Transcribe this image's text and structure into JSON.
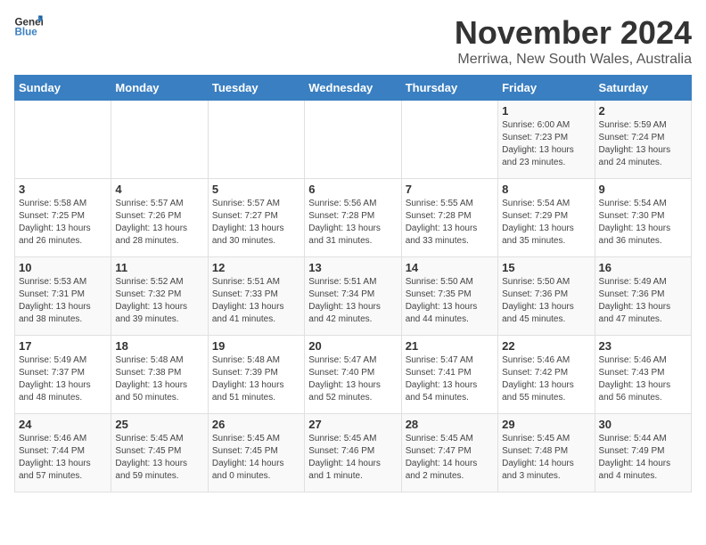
{
  "logo": {
    "general": "General",
    "blue": "Blue"
  },
  "title": "November 2024",
  "location": "Merriwa, New South Wales, Australia",
  "weekdays": [
    "Sunday",
    "Monday",
    "Tuesday",
    "Wednesday",
    "Thursday",
    "Friday",
    "Saturday"
  ],
  "weeks": [
    [
      {
        "day": "",
        "info": ""
      },
      {
        "day": "",
        "info": ""
      },
      {
        "day": "",
        "info": ""
      },
      {
        "day": "",
        "info": ""
      },
      {
        "day": "",
        "info": ""
      },
      {
        "day": "1",
        "info": "Sunrise: 6:00 AM\nSunset: 7:23 PM\nDaylight: 13 hours\nand 23 minutes."
      },
      {
        "day": "2",
        "info": "Sunrise: 5:59 AM\nSunset: 7:24 PM\nDaylight: 13 hours\nand 24 minutes."
      }
    ],
    [
      {
        "day": "3",
        "info": "Sunrise: 5:58 AM\nSunset: 7:25 PM\nDaylight: 13 hours\nand 26 minutes."
      },
      {
        "day": "4",
        "info": "Sunrise: 5:57 AM\nSunset: 7:26 PM\nDaylight: 13 hours\nand 28 minutes."
      },
      {
        "day": "5",
        "info": "Sunrise: 5:57 AM\nSunset: 7:27 PM\nDaylight: 13 hours\nand 30 minutes."
      },
      {
        "day": "6",
        "info": "Sunrise: 5:56 AM\nSunset: 7:28 PM\nDaylight: 13 hours\nand 31 minutes."
      },
      {
        "day": "7",
        "info": "Sunrise: 5:55 AM\nSunset: 7:28 PM\nDaylight: 13 hours\nand 33 minutes."
      },
      {
        "day": "8",
        "info": "Sunrise: 5:54 AM\nSunset: 7:29 PM\nDaylight: 13 hours\nand 35 minutes."
      },
      {
        "day": "9",
        "info": "Sunrise: 5:54 AM\nSunset: 7:30 PM\nDaylight: 13 hours\nand 36 minutes."
      }
    ],
    [
      {
        "day": "10",
        "info": "Sunrise: 5:53 AM\nSunset: 7:31 PM\nDaylight: 13 hours\nand 38 minutes."
      },
      {
        "day": "11",
        "info": "Sunrise: 5:52 AM\nSunset: 7:32 PM\nDaylight: 13 hours\nand 39 minutes."
      },
      {
        "day": "12",
        "info": "Sunrise: 5:51 AM\nSunset: 7:33 PM\nDaylight: 13 hours\nand 41 minutes."
      },
      {
        "day": "13",
        "info": "Sunrise: 5:51 AM\nSunset: 7:34 PM\nDaylight: 13 hours\nand 42 minutes."
      },
      {
        "day": "14",
        "info": "Sunrise: 5:50 AM\nSunset: 7:35 PM\nDaylight: 13 hours\nand 44 minutes."
      },
      {
        "day": "15",
        "info": "Sunrise: 5:50 AM\nSunset: 7:36 PM\nDaylight: 13 hours\nand 45 minutes."
      },
      {
        "day": "16",
        "info": "Sunrise: 5:49 AM\nSunset: 7:36 PM\nDaylight: 13 hours\nand 47 minutes."
      }
    ],
    [
      {
        "day": "17",
        "info": "Sunrise: 5:49 AM\nSunset: 7:37 PM\nDaylight: 13 hours\nand 48 minutes."
      },
      {
        "day": "18",
        "info": "Sunrise: 5:48 AM\nSunset: 7:38 PM\nDaylight: 13 hours\nand 50 minutes."
      },
      {
        "day": "19",
        "info": "Sunrise: 5:48 AM\nSunset: 7:39 PM\nDaylight: 13 hours\nand 51 minutes."
      },
      {
        "day": "20",
        "info": "Sunrise: 5:47 AM\nSunset: 7:40 PM\nDaylight: 13 hours\nand 52 minutes."
      },
      {
        "day": "21",
        "info": "Sunrise: 5:47 AM\nSunset: 7:41 PM\nDaylight: 13 hours\nand 54 minutes."
      },
      {
        "day": "22",
        "info": "Sunrise: 5:46 AM\nSunset: 7:42 PM\nDaylight: 13 hours\nand 55 minutes."
      },
      {
        "day": "23",
        "info": "Sunrise: 5:46 AM\nSunset: 7:43 PM\nDaylight: 13 hours\nand 56 minutes."
      }
    ],
    [
      {
        "day": "24",
        "info": "Sunrise: 5:46 AM\nSunset: 7:44 PM\nDaylight: 13 hours\nand 57 minutes."
      },
      {
        "day": "25",
        "info": "Sunrise: 5:45 AM\nSunset: 7:45 PM\nDaylight: 13 hours\nand 59 minutes."
      },
      {
        "day": "26",
        "info": "Sunrise: 5:45 AM\nSunset: 7:45 PM\nDaylight: 14 hours\nand 0 minutes."
      },
      {
        "day": "27",
        "info": "Sunrise: 5:45 AM\nSunset: 7:46 PM\nDaylight: 14 hours\nand 1 minute."
      },
      {
        "day": "28",
        "info": "Sunrise: 5:45 AM\nSunset: 7:47 PM\nDaylight: 14 hours\nand 2 minutes."
      },
      {
        "day": "29",
        "info": "Sunrise: 5:45 AM\nSunset: 7:48 PM\nDaylight: 14 hours\nand 3 minutes."
      },
      {
        "day": "30",
        "info": "Sunrise: 5:44 AM\nSunset: 7:49 PM\nDaylight: 14 hours\nand 4 minutes."
      }
    ]
  ]
}
